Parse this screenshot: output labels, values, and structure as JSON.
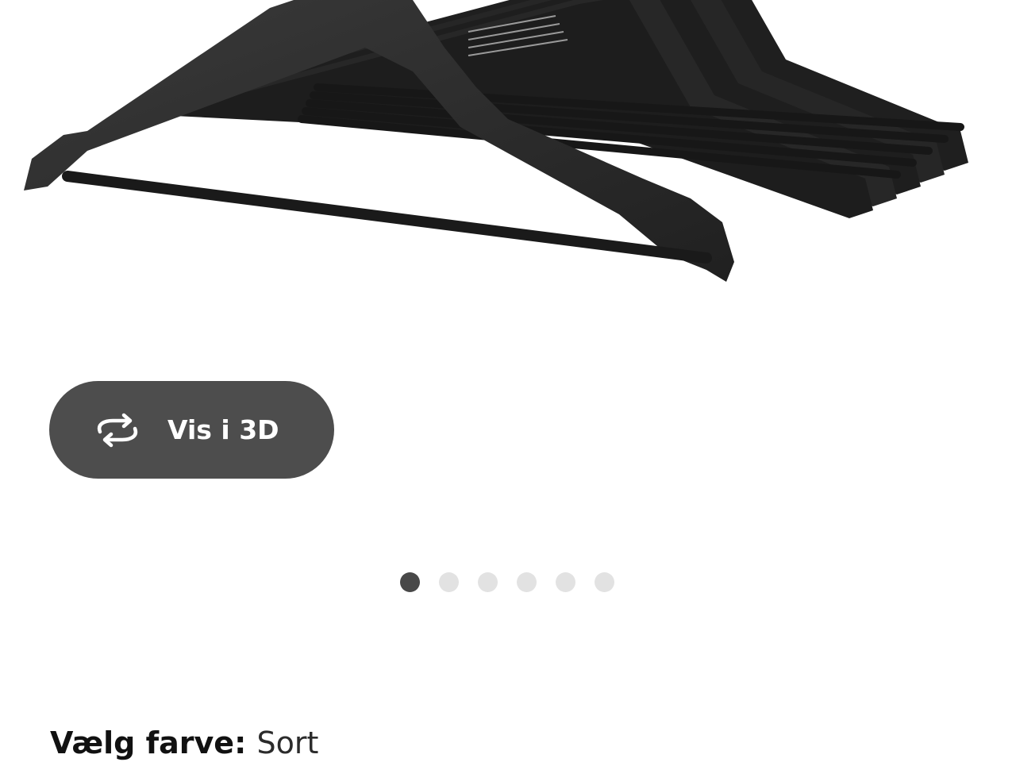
{
  "view_3d_button": {
    "label": "Vis i 3D",
    "icon": "rotate-3d-icon"
  },
  "carousel": {
    "total": 6,
    "active_index": 0,
    "active_color": "#484848",
    "inactive_color": "#e2e2e2"
  },
  "color_selector": {
    "label": "Vælg farve:",
    "value": "Sort"
  },
  "colors": {
    "button_bg": "#4d4d4d",
    "product": "#2a2a2a"
  }
}
